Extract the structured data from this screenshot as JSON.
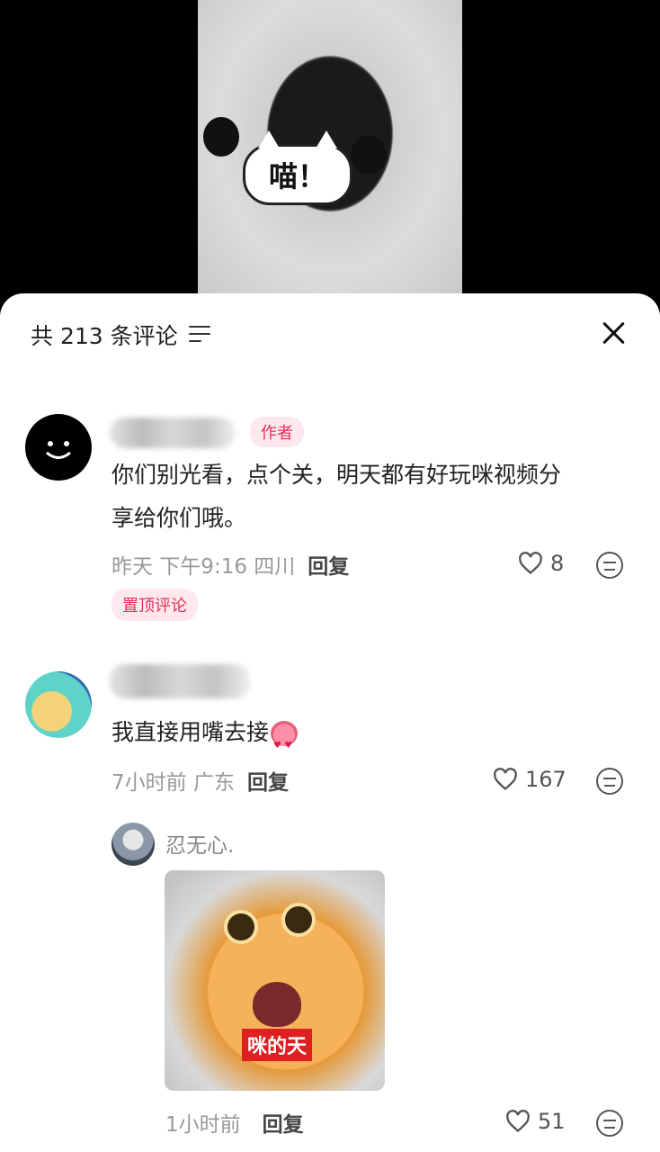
{
  "video": {
    "bubble_text": "喵！"
  },
  "header": {
    "title": "共 213 条评论"
  },
  "comments": [
    {
      "badge": "作者",
      "text_line1": "你们别光看，点个关，明天都有好玩咪视频分",
      "text_line2": "享给你们哦。",
      "meta": "昨天 下午9:16 四川",
      "reply_label": "回复",
      "likes": "8",
      "pinned_label": "置顶评论"
    },
    {
      "text": "我直接用嘴去接",
      "meta": "7小时前 广东",
      "reply_label": "回复",
      "likes": "167",
      "subreply": {
        "username": "忍无心.",
        "sticker_text": "咪的天",
        "meta": "1小时前",
        "reply_label": "回复",
        "likes": "51"
      }
    }
  ],
  "colors": {
    "accent": "#e8305a",
    "badge_bg": "#fde8ee"
  }
}
